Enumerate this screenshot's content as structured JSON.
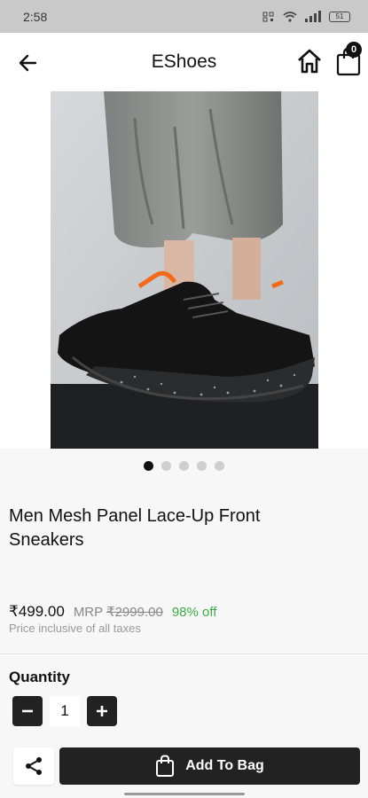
{
  "status_bar": {
    "time": "2:58",
    "battery": "51"
  },
  "app_bar": {
    "title": "EShoes",
    "icons": {
      "back": "arrow-left-icon",
      "home": "home-icon",
      "bag": "shopping-bag-icon"
    },
    "bag_count": "0"
  },
  "gallery": {
    "image_count": 5,
    "active_index": 0
  },
  "product": {
    "name": "Men Mesh Panel Lace-Up Front Sneakers",
    "price": "₹499.00",
    "mrp_label": "MRP",
    "mrp": "₹2999.00",
    "discount": "98% off",
    "tax_note": "Price inclusive of all taxes"
  },
  "quantity": {
    "label": "Quantity",
    "value": "1"
  },
  "actions": {
    "add_to_bag": "Add To Bag",
    "share_icon": "share-icon"
  },
  "colors": {
    "primary": "#222222",
    "discount": "#3fa84a",
    "status_bar": "#c9c9c9"
  }
}
